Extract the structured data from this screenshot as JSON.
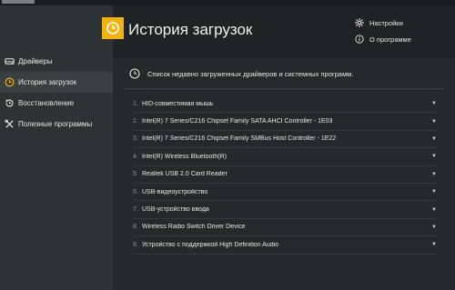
{
  "sidebar": {
    "items": [
      {
        "label": "Драйверы",
        "icon": "drive-icon",
        "active": false
      },
      {
        "label": "История загрузок",
        "icon": "clock-icon",
        "active": true
      },
      {
        "label": "Восстановление",
        "icon": "restore-icon",
        "active": false
      },
      {
        "label": "Полезные программы",
        "icon": "tools-icon",
        "active": false
      }
    ]
  },
  "header": {
    "title": "История загрузок",
    "settings_label": "Настройки",
    "about_label": "О программе"
  },
  "main": {
    "description": "Список недавно загруженных драйверов и системных программ.",
    "items": [
      {
        "num": "1.",
        "name": "HID-совместимая мышь"
      },
      {
        "num": "2.",
        "name": "Intel(R) 7 Series/C216 Chipset Family SATA AHCI Controller - 1E03"
      },
      {
        "num": "3.",
        "name": "Intel(R) 7 Series/C216 Chipset Family SMBus Host Controller - 1E22"
      },
      {
        "num": "4.",
        "name": "Intel(R) Wireless Bluetooth(R)"
      },
      {
        "num": "5.",
        "name": "Realtek USB 2.0 Card Reader"
      },
      {
        "num": "6.",
        "name": "USB-видеоустройство"
      },
      {
        "num": "7.",
        "name": "USB-устройство ввода"
      },
      {
        "num": "8.",
        "name": "Wireless Radio Switch Driver Device"
      },
      {
        "num": "9.",
        "name": "Устройство с поддержкой High Definition Audio"
      }
    ]
  },
  "colors": {
    "accent": "#f2b20f",
    "sidebar": "#2e3235",
    "main": "#25292c",
    "background": "#1f2326"
  }
}
